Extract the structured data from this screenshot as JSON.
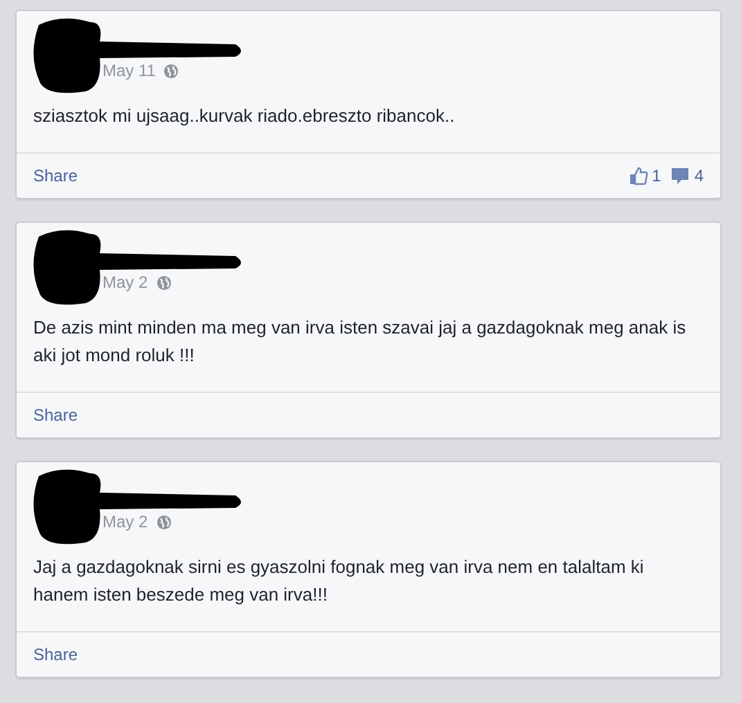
{
  "posts": [
    {
      "date": "May 11",
      "text": "sziasztok mi ujsaag..kurvak riado.ebreszto ribancok..",
      "share": "Share",
      "likes": "1",
      "comments": "4"
    },
    {
      "date": "May 2",
      "text": "De azis mint minden ma meg van irva isten szavai jaj a gazdagoknak meg anak is aki jot mond roluk !!!",
      "share": "Share"
    },
    {
      "date": "May 2",
      "text": "Jaj a gazdagoknak sirni es gyaszolni fognak meg van irva nem en talaltam ki hanem isten beszede meg van irva!!!",
      "share": "Share"
    }
  ]
}
